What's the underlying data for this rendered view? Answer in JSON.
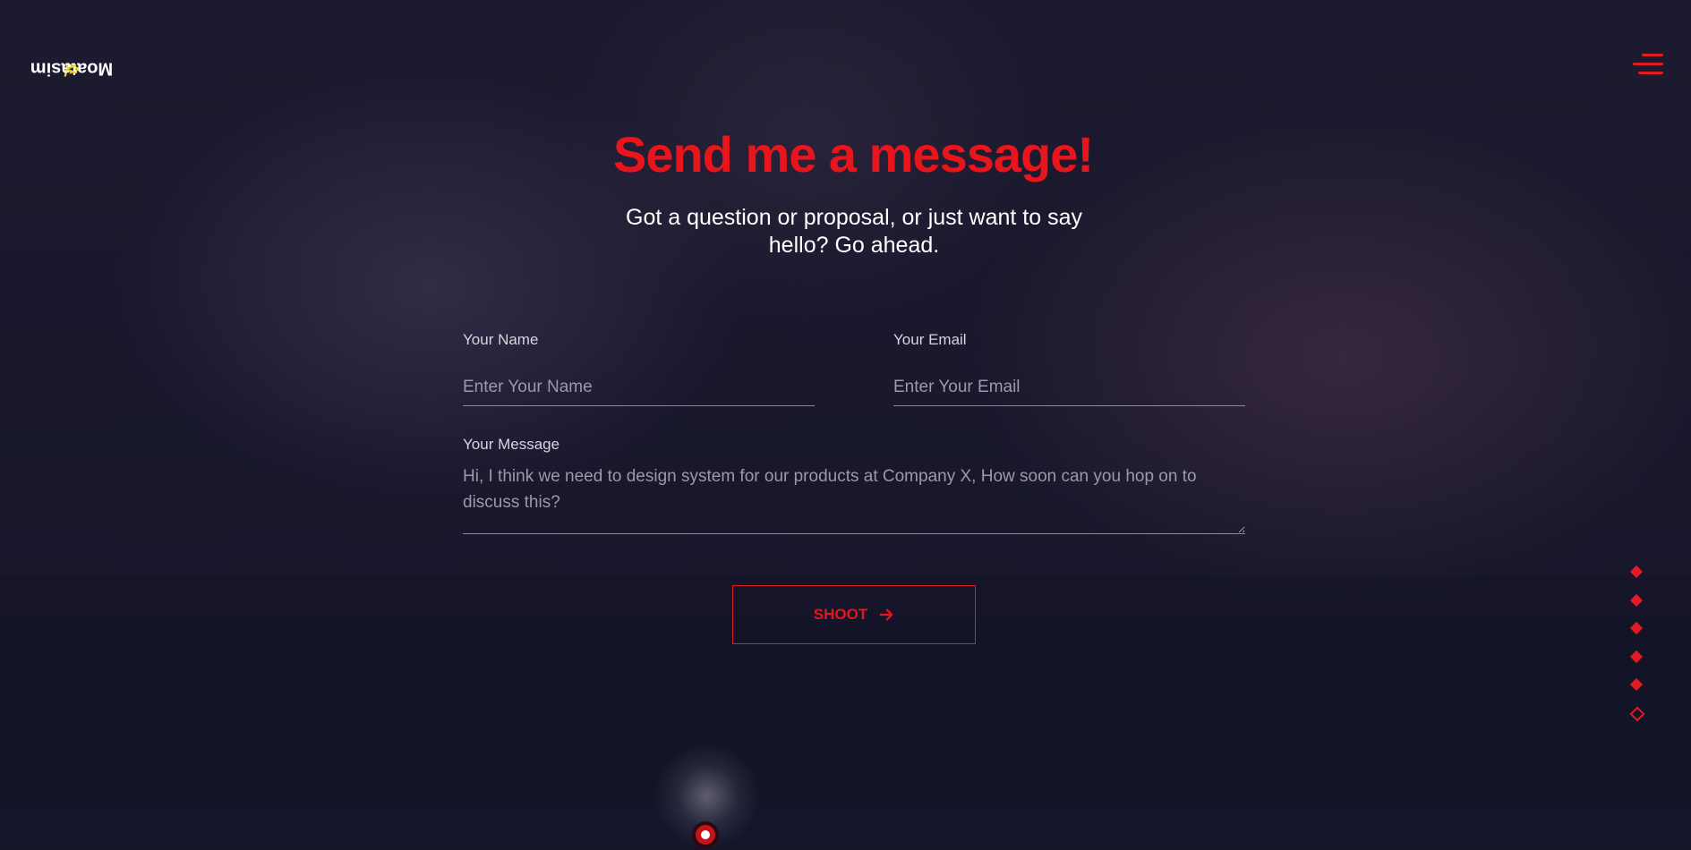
{
  "brand": {
    "logo_prefix": "</",
    "logo_name": "Moatasim",
    "logo_suffix": ">"
  },
  "contact": {
    "heading": "Send me a message!",
    "subheading": "Got a question or proposal, or just want to say hello? Go ahead.",
    "name_label": "Your Name",
    "name_placeholder": "Enter Your Name",
    "email_label": "Your Email",
    "email_placeholder": "Enter Your Email",
    "message_label": "Your Message",
    "message_placeholder": "Hi, I think we need to design system for our products at Company X, How soon can you hop on to discuss this?",
    "submit_label": "SHOOT"
  },
  "colors": {
    "accent": "#e8151c",
    "logo_bracket": "#e8d21a",
    "background": "#15152a"
  },
  "icons": {
    "menu": "hamburger-icon",
    "submit": "arrow-right-icon",
    "section_nav": "diamond-icon"
  },
  "section_nav": {
    "count": 6,
    "active_index": 5
  }
}
